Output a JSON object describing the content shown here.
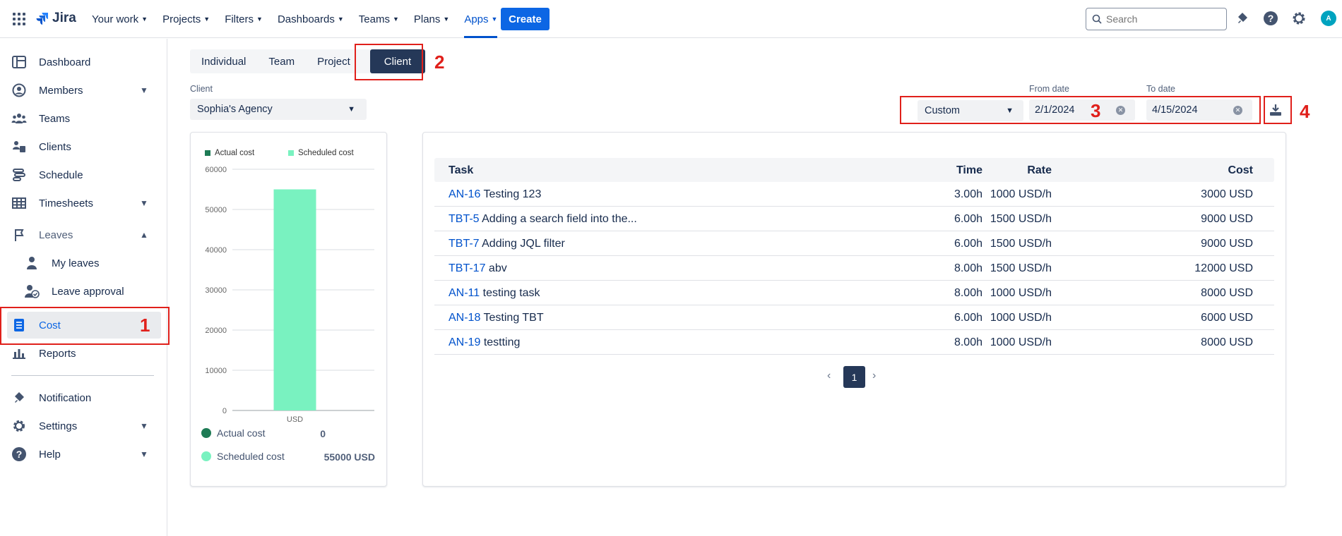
{
  "topbar": {
    "logo_text": "Jira",
    "nav": [
      {
        "label": "Your work"
      },
      {
        "label": "Projects"
      },
      {
        "label": "Filters"
      },
      {
        "label": "Dashboards"
      },
      {
        "label": "Teams"
      },
      {
        "label": "Plans"
      },
      {
        "label": "Apps"
      }
    ],
    "create_label": "Create",
    "search_placeholder": "Search",
    "avatar_initial": "A",
    "accent": "#0c66e4"
  },
  "sidebar": {
    "items": [
      {
        "label": "Dashboard"
      },
      {
        "label": "Members"
      },
      {
        "label": "Teams"
      },
      {
        "label": "Clients"
      },
      {
        "label": "Schedule"
      },
      {
        "label": "Timesheets"
      },
      {
        "label": "Leaves"
      },
      {
        "label": "My leaves"
      },
      {
        "label": "Leave approval"
      },
      {
        "label": "Cost"
      },
      {
        "label": "Reports"
      },
      {
        "label": "Notification"
      },
      {
        "label": "Settings"
      },
      {
        "label": "Help"
      }
    ]
  },
  "annotations": {
    "n1": "1",
    "n2": "2",
    "n3": "3",
    "n4": "4"
  },
  "tabs": [
    {
      "label": "Individual"
    },
    {
      "label": "Team"
    },
    {
      "label": "Project"
    },
    {
      "label": "Client"
    }
  ],
  "filters": {
    "client_label": "Client",
    "client_value": "Sophia's Agency",
    "range_value": "Custom",
    "from_label": "From date",
    "from_value": "2/1/2024",
    "to_label": "To date",
    "to_value": "4/15/2024"
  },
  "chart_data": {
    "type": "bar",
    "categories": [
      "USD"
    ],
    "series": [
      {
        "name": "Actual cost",
        "values": [
          0
        ],
        "color": "#1e7b55"
      },
      {
        "name": "Scheduled cost",
        "values": [
          55000
        ],
        "color": "#79f2c0"
      }
    ],
    "yticks": [
      "60000",
      "50000",
      "40000",
      "30000",
      "20000",
      "10000",
      "0"
    ],
    "ylim": [
      0,
      60000
    ],
    "legend": "top",
    "summary": [
      {
        "name": "Actual cost",
        "value": "0"
      },
      {
        "name": "Scheduled cost",
        "value": "55000 USD"
      }
    ]
  },
  "table": {
    "headers": {
      "task": "Task",
      "time": "Time",
      "rate": "Rate",
      "cost": "Cost"
    },
    "rows": [
      {
        "key": "AN-16",
        "title": "Testing 123",
        "time": "3.00h",
        "rate": "1000 USD/h",
        "cost": "3000 USD"
      },
      {
        "key": "TBT-5",
        "title": "Adding a search field into the...",
        "time": "6.00h",
        "rate": "1500 USD/h",
        "cost": "9000 USD"
      },
      {
        "key": "TBT-7",
        "title": "Adding JQL filter",
        "time": "6.00h",
        "rate": "1500 USD/h",
        "cost": "9000 USD"
      },
      {
        "key": "TBT-17",
        "title": "abv",
        "time": "8.00h",
        "rate": "1500 USD/h",
        "cost": "12000 USD"
      },
      {
        "key": "AN-11",
        "title": "testing task",
        "time": "8.00h",
        "rate": "1000 USD/h",
        "cost": "8000 USD"
      },
      {
        "key": "AN-18",
        "title": "Testing TBT",
        "time": "6.00h",
        "rate": "1000 USD/h",
        "cost": "6000 USD"
      },
      {
        "key": "AN-19",
        "title": "testting",
        "time": "8.00h",
        "rate": "1000 USD/h",
        "cost": "8000 USD"
      }
    ]
  },
  "pagination": {
    "current": "1"
  }
}
